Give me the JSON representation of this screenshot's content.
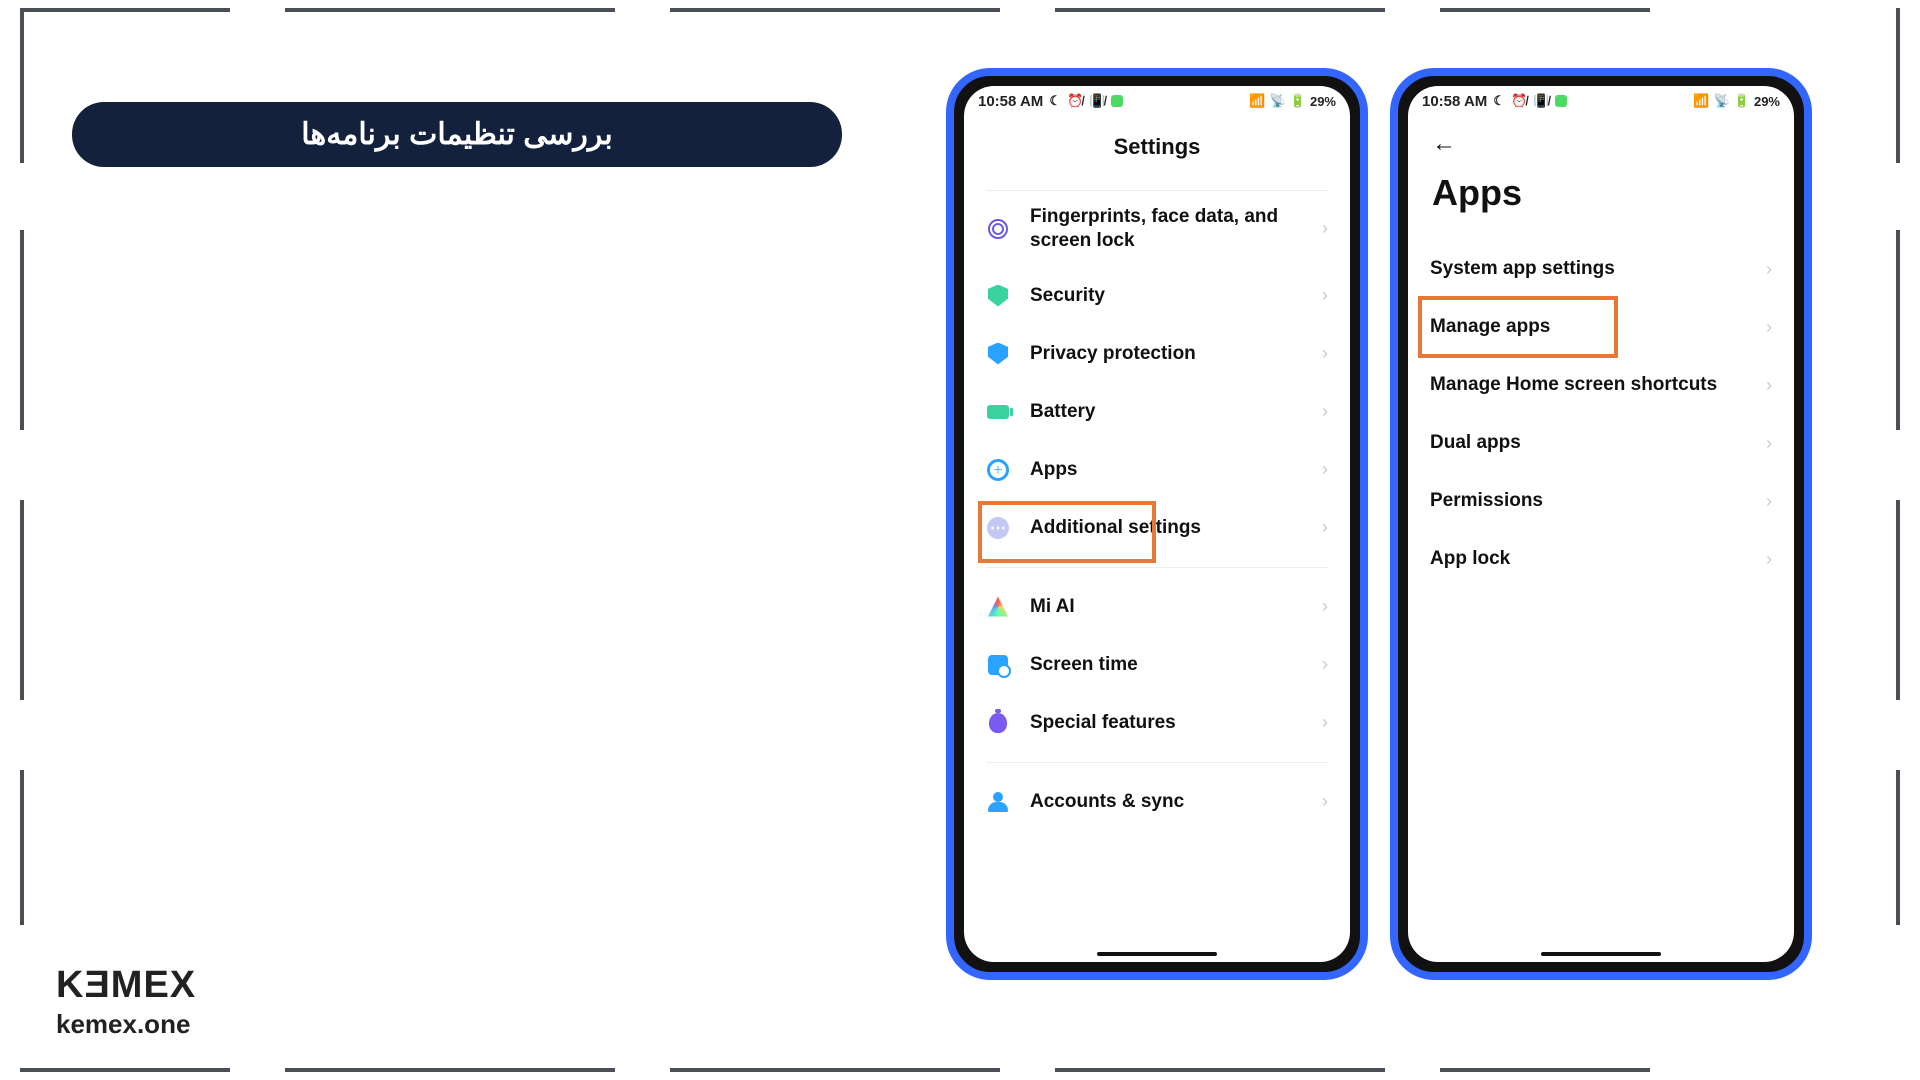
{
  "slide": {
    "title_fa": "بررسی تنظیمات برنامه‌ها"
  },
  "branding": {
    "logo_main": "KƎMEX",
    "logo_sub": "kemex.one"
  },
  "statusbar": {
    "time": "10:58 AM",
    "battery_percent": "29%",
    "icons_desc": "moon, no-alarm, no-vibrate, green-app, signal, wifi, battery-charging"
  },
  "phone1": {
    "header": "Settings",
    "rows": [
      {
        "label": "Fingerprints, face data, and screen lock",
        "icon": "fingerprint-icon"
      },
      {
        "label": "Security",
        "icon": "shield-icon"
      },
      {
        "label": "Privacy protection",
        "icon": "privacy-icon"
      },
      {
        "label": "Battery",
        "icon": "battery-icon"
      },
      {
        "label": "Apps",
        "icon": "gear-icon",
        "highlighted": true
      },
      {
        "label": "Additional settings",
        "icon": "dots-icon"
      }
    ],
    "rows2": [
      {
        "label": "Mi AI",
        "icon": "miai-icon"
      },
      {
        "label": "Screen time",
        "icon": "screentime-icon"
      },
      {
        "label": "Special features",
        "icon": "special-icon"
      }
    ],
    "rows3": [
      {
        "label": "Accounts & sync",
        "icon": "accounts-icon"
      }
    ],
    "highlight_color": "#e87838"
  },
  "phone2": {
    "header": "Apps",
    "rows": [
      {
        "label": "System app settings"
      },
      {
        "label": "Manage apps",
        "highlighted": true
      },
      {
        "label": "Manage Home screen shortcuts"
      },
      {
        "label": "Dual apps"
      },
      {
        "label": "Permissions"
      },
      {
        "label": "App lock"
      }
    ],
    "highlight_color": "#e87838"
  }
}
